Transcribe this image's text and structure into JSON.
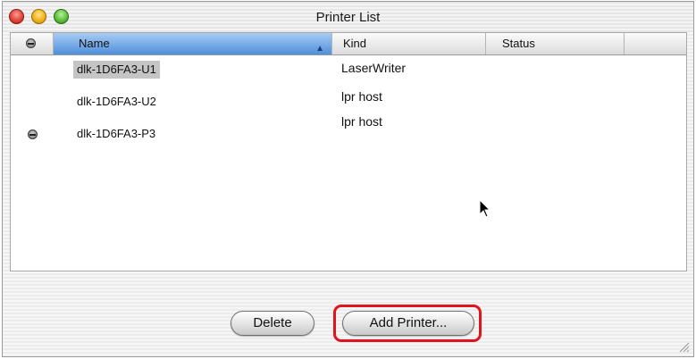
{
  "window": {
    "title": "Printer List"
  },
  "columns": {
    "name": "Name",
    "kind": "Kind",
    "status": "Status"
  },
  "printers": [
    {
      "name": "dlk-1D6FA3-U1",
      "kind": "LaserWriter",
      "status": "",
      "selected": true,
      "default": false
    },
    {
      "name": "dlk-1D6FA3-U2",
      "kind": "lpr host",
      "status": "",
      "selected": false,
      "default": false
    },
    {
      "name": "dlk-1D6FA3-P3",
      "kind": "lpr host",
      "status": "",
      "selected": false,
      "default": true
    }
  ],
  "buttons": {
    "delete": "Delete",
    "add_printer": "Add Printer..."
  },
  "colors": {
    "highlight": "#e0141c",
    "sorted_column": "#4f8fdc"
  }
}
